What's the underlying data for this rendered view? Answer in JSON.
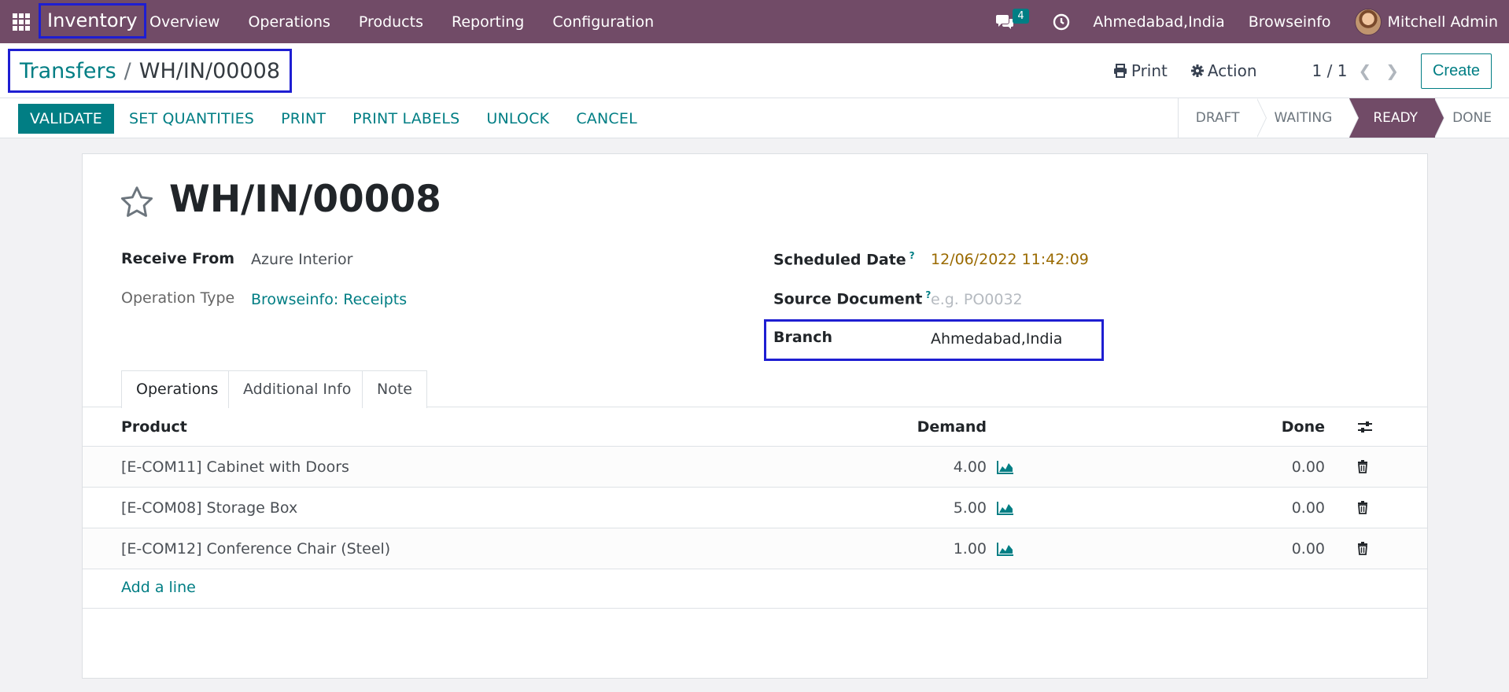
{
  "navbar": {
    "app_name": "Inventory",
    "menu": [
      "Overview",
      "Operations",
      "Products",
      "Reporting",
      "Configuration"
    ],
    "chat_count": "4",
    "branch": "Ahmedabad,India",
    "company": "Browseinfo",
    "user": "Mitchell Admin"
  },
  "breadcrumb": {
    "parent": "Transfers",
    "separator": "/",
    "current": "WH/IN/00008"
  },
  "control": {
    "print_label": "Print",
    "action_label": "Action",
    "pager": "1 / 1",
    "create_label": "Create"
  },
  "statusbar": {
    "buttons": [
      "VALIDATE",
      "SET QUANTITIES",
      "PRINT",
      "PRINT LABELS",
      "UNLOCK",
      "CANCEL"
    ],
    "stages": [
      "DRAFT",
      "WAITING",
      "READY",
      "DONE"
    ],
    "active_stage": "READY"
  },
  "form": {
    "name": "WH/IN/00008",
    "receive_from_label": "Receive From",
    "receive_from": "Azure Interior",
    "operation_type_label": "Operation Type",
    "operation_type": "Browseinfo: Receipts",
    "scheduled_date_label": "Scheduled Date",
    "scheduled_date": "12/06/2022 11:42:09",
    "source_document_label": "Source Document",
    "source_document_placeholder": "e.g. PO0032",
    "branch_label": "Branch",
    "branch": "Ahmedabad,India",
    "help_mark": "?"
  },
  "tabs": [
    "Operations",
    "Additional Info",
    "Note"
  ],
  "table": {
    "headers": {
      "product": "Product",
      "demand": "Demand",
      "done": "Done"
    },
    "rows": [
      {
        "product": "[E-COM11] Cabinet with Doors",
        "demand": "4.00",
        "done": "0.00"
      },
      {
        "product": "[E-COM08] Storage Box",
        "demand": "5.00",
        "done": "0.00"
      },
      {
        "product": "[E-COM12] Conference Chair (Steel)",
        "demand": "1.00",
        "done": "0.00"
      }
    ],
    "add_line": "Add a line"
  },
  "colors": {
    "brand": "#714b67",
    "accent": "#017e84",
    "highlight_box": "#1e1ed2"
  }
}
